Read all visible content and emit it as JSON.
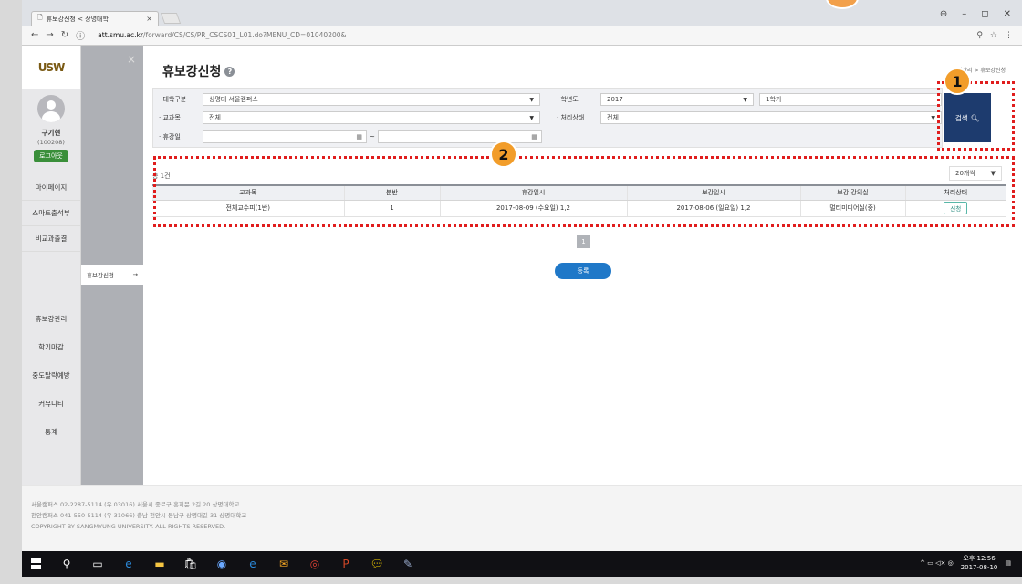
{
  "browser": {
    "tab_title": "휴보강신청 < 상명대학",
    "tab_close": "×",
    "url_host": "att.smu.ac.kr",
    "url_path": "/forward/CS/CS/PR_CSCS01_L01.do?MENU_CD=01040200&",
    "icons": {
      "back": "arrow-left",
      "forward": "arrow-right",
      "reload": "reload",
      "info": "info",
      "zoom": "magnifier",
      "star": "star",
      "more": "kebab"
    }
  },
  "sidebar": {
    "logo": "USW",
    "user_name": "구기현",
    "user_id": "(100208)",
    "logout_label": "로그아웃",
    "menu_top": [
      {
        "label": "마이페이지"
      },
      {
        "label": "스마트출석부"
      },
      {
        "label": "비교과출결"
      }
    ],
    "menu_bottom": [
      {
        "label": "휴보강관리"
      },
      {
        "label": "학기마감"
      },
      {
        "label": "중도탈락예방"
      },
      {
        "label": "커뮤니티"
      },
      {
        "label": "통계"
      }
    ]
  },
  "submenu": {
    "close": "×",
    "active_item": "휴보강신청",
    "arrow": "→"
  },
  "main": {
    "title": "휴보강신청",
    "help": "?",
    "breadcrumb": "강관리 > 휴보강신청",
    "filters": {
      "campus_label": "대학구분",
      "campus_value": "상명대 서울캠퍼스",
      "year_label": "학년도",
      "year_value": "2017",
      "semester_value": "1학기",
      "course_label": "교과목",
      "course_value": "전체",
      "status_label": "처리상태",
      "status_value": "전체",
      "date_label": "휴강일",
      "date_sep": "~"
    },
    "search_label": "검색",
    "count_text": "총 1건",
    "page_size": "20개씩",
    "table": {
      "headers": [
        "교과목",
        "분반",
        "휴강일시",
        "보강일시",
        "보강 강의실",
        "처리상태"
      ],
      "rows": [
        [
          "전체교수피(1반)",
          "1",
          "2017-08-09 (수요일) 1,2",
          "2017-08-06 (일요일) 1,2",
          "멀티미디어실(중)",
          "신청"
        ]
      ]
    },
    "page_number": "1",
    "register_label": "등록"
  },
  "footer": {
    "line1": "서울캠퍼스 02-2287-5114 (우 03016) 서울시 종로구 홍지문 2길 20 상명대학교",
    "line2": "천안캠퍼스 041-550-5114 (우 31066) 충남 천안시 동남구 상명대길 31 상명대학교",
    "line3": "COPYRIGHT BY SANGMYUNG UNIVERSITY. ALL RIGHTS RESERVED."
  },
  "annotations": {
    "badge1": "1",
    "badge2": "2",
    "color": "#e01d1d",
    "badge_color": "#f29d2a"
  },
  "taskbar": {
    "time": "오후 12:56",
    "date": "2017-08-10"
  }
}
